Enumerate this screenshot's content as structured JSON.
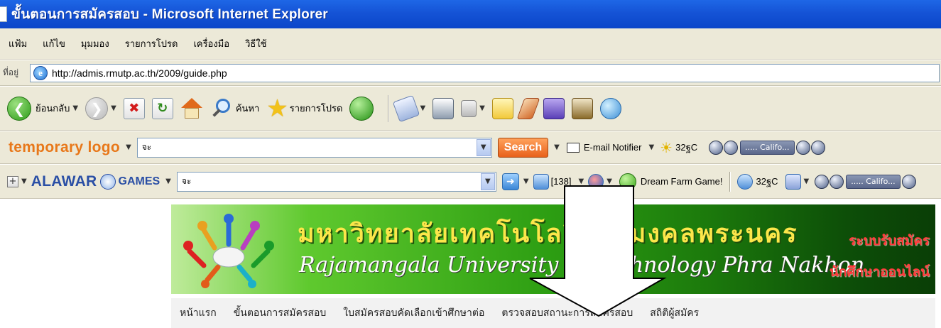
{
  "window": {
    "title": "ขั้นตอนการสมัครสอบ - Microsoft Internet Explorer"
  },
  "menubar": {
    "items": [
      "แฟ้ม",
      "แก้ไข",
      "มุมมอง",
      "รายการโปรด",
      "เครื่องมือ",
      "วิธีใช้"
    ]
  },
  "address": {
    "label": "ที่อยู่",
    "url": "http://admis.rmutp.ac.th/2009/guide.php"
  },
  "toolbar": {
    "back_label": "ย้อนกลับ",
    "search_label": "ค้นหา",
    "favorites_label": "รายการโปรด"
  },
  "toolbar2": {
    "logo": "temporary logo",
    "search_value": "จะ",
    "search_button": "Search",
    "email_label": "E-mail Notifier",
    "temperature": "32ฐC",
    "station": "..... Califo..."
  },
  "toolbar3": {
    "brand": "ALAWAR",
    "games_label": "GAMES",
    "search_value": "จะ",
    "count": "[138]",
    "farm_label": "Dream Farm Game!",
    "temperature": "32ฐC",
    "station": "..... Califo..."
  },
  "banner": {
    "title_th": "มหาวิทยาลัยเทคโนโลยีราชมงคลพระนคร",
    "title_en": "Rajamangala University of Technology Phra Nakhon",
    "side_line1": "ระบบรับสมัคร",
    "side_line2": "นักศึกษาออนไลน์"
  },
  "nav": {
    "items": [
      "หน้าแรก",
      "ขั้นตอนการสมัครสอบ",
      "ใบสมัครสอบคัดเลือกเข้าศึกษาต่อ",
      "ตรวจสอบสถานะการสมัครสอบ",
      "สถิติผู้สมัคร"
    ]
  },
  "colors": {
    "title_bar": "#1553d6",
    "chrome": "#ece9d8",
    "temp_logo": "#e8781a",
    "alawar": "#2a4fa5",
    "banner_title": "#fce64a",
    "banner_side": "#ff3b3b"
  }
}
